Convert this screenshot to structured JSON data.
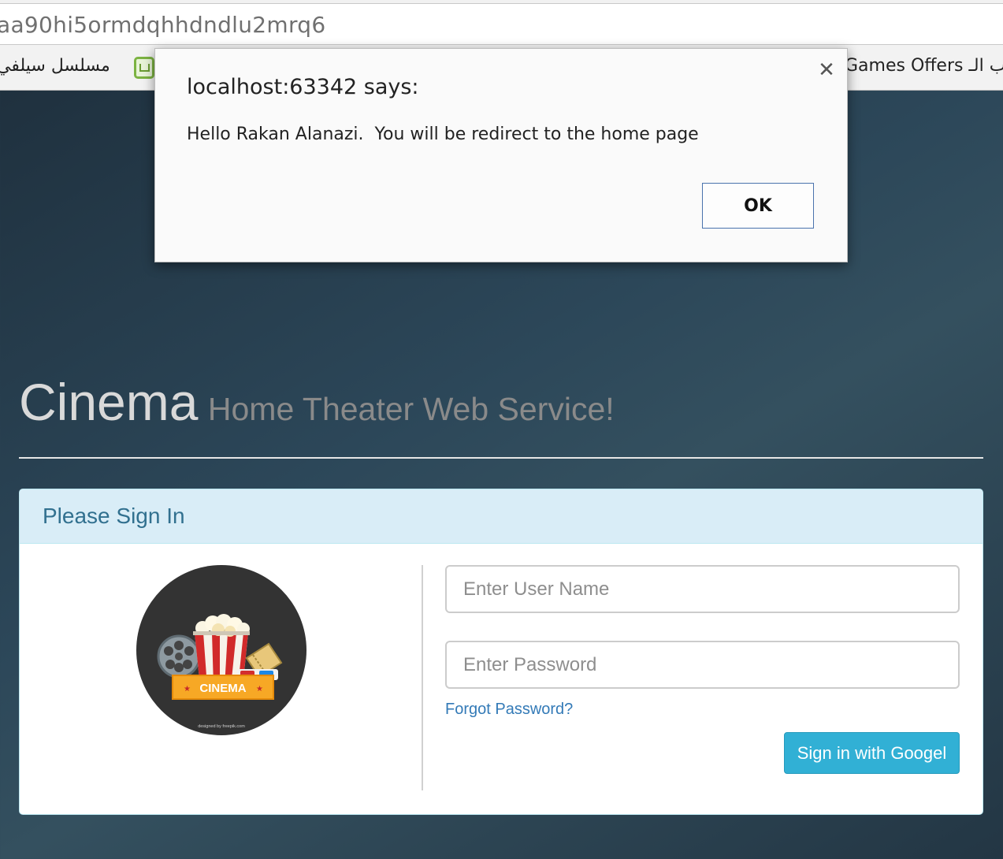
{
  "browser": {
    "url": "aa90hi5ormdqhhdndlu2mrq6",
    "bookmarks": [
      {
        "label": "مسلسل سيلفي"
      },
      {
        "label": "Games Offers باب الـ"
      }
    ]
  },
  "page": {
    "title": "Cinema",
    "subtitle": "Home Theater Web Service!"
  },
  "signin": {
    "heading": "Please Sign In",
    "username_placeholder": "Enter User Name",
    "password_placeholder": "Enter Password",
    "forgot_label": "Forgot Password?",
    "google_label": "Sign in with Googel",
    "logo": {
      "banner_text": "CINEMA",
      "credit_text": "designed by freepik.com"
    }
  },
  "dialog": {
    "title": "localhost:63342 says:",
    "message": "Hello Rakan Alanazi.  You will be redirect to the home page",
    "ok_label": "OK",
    "close_icon": "close-icon"
  },
  "colors": {
    "panel_heading_bg": "#d9edf7",
    "panel_heading_text": "#31708f",
    "link": "#337ab7",
    "google_button": "#31b0d5",
    "ok_border": "#4a73ad"
  }
}
